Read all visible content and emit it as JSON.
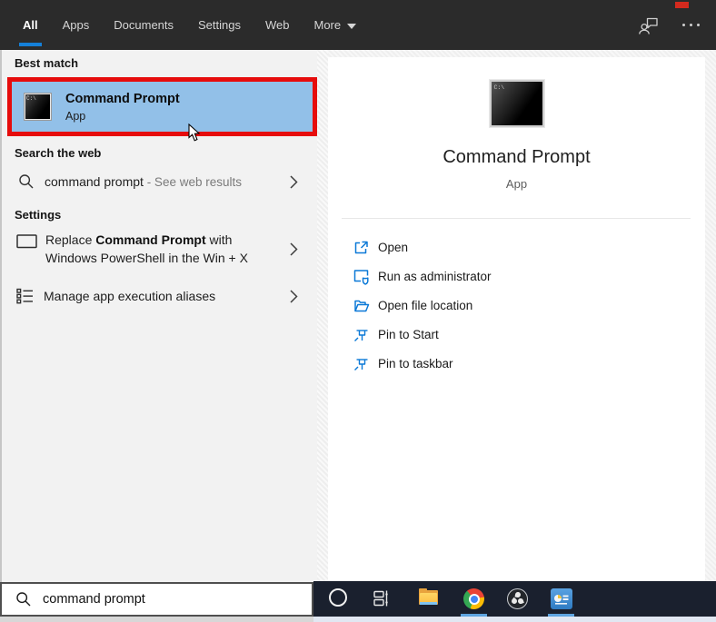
{
  "header": {
    "tabs": [
      {
        "label": "All",
        "active": true
      },
      {
        "label": "Apps",
        "active": false
      },
      {
        "label": "Documents",
        "active": false
      },
      {
        "label": "Settings",
        "active": false
      },
      {
        "label": "Web",
        "active": false
      },
      {
        "label": "More",
        "active": false
      }
    ]
  },
  "app": {
    "name": "Command Prompt",
    "type": "App",
    "icon_text": "C:\\"
  },
  "left_panel": {
    "best_match": {
      "title": "Best match"
    },
    "search_web": {
      "title": "Search the web",
      "item": {
        "query": "command prompt",
        "suffix": " - See web results"
      }
    },
    "settings": {
      "title": "Settings",
      "items": [
        {
          "prefix": "Replace ",
          "bold": "Command Prompt",
          "suffix": " with Windows PowerShell in the Win + X"
        },
        {
          "label": "Manage app execution aliases"
        }
      ]
    }
  },
  "right_panel": {
    "actions": [
      {
        "icon": "open-icon",
        "label": "Open"
      },
      {
        "icon": "shield-icon",
        "label": "Run as administrator"
      },
      {
        "icon": "folder-icon",
        "label": "Open file location"
      },
      {
        "icon": "pin-icon",
        "label": "Pin to Start"
      },
      {
        "icon": "pin-icon",
        "label": "Pin to taskbar"
      }
    ]
  },
  "search_bar": {
    "value": "command prompt"
  },
  "colors": {
    "header_bg": "#2b2b2b",
    "active_tab_underline": "#1580d8",
    "left_panel_bg": "#f2f2f2",
    "highlight_blue": "#92c0e8",
    "annotation_red": "#e60c0c",
    "action_icon_blue": "#0b79d7",
    "taskbar_bg": "#1a202e",
    "taskbar_active_underline": "#5ea4e0"
  }
}
